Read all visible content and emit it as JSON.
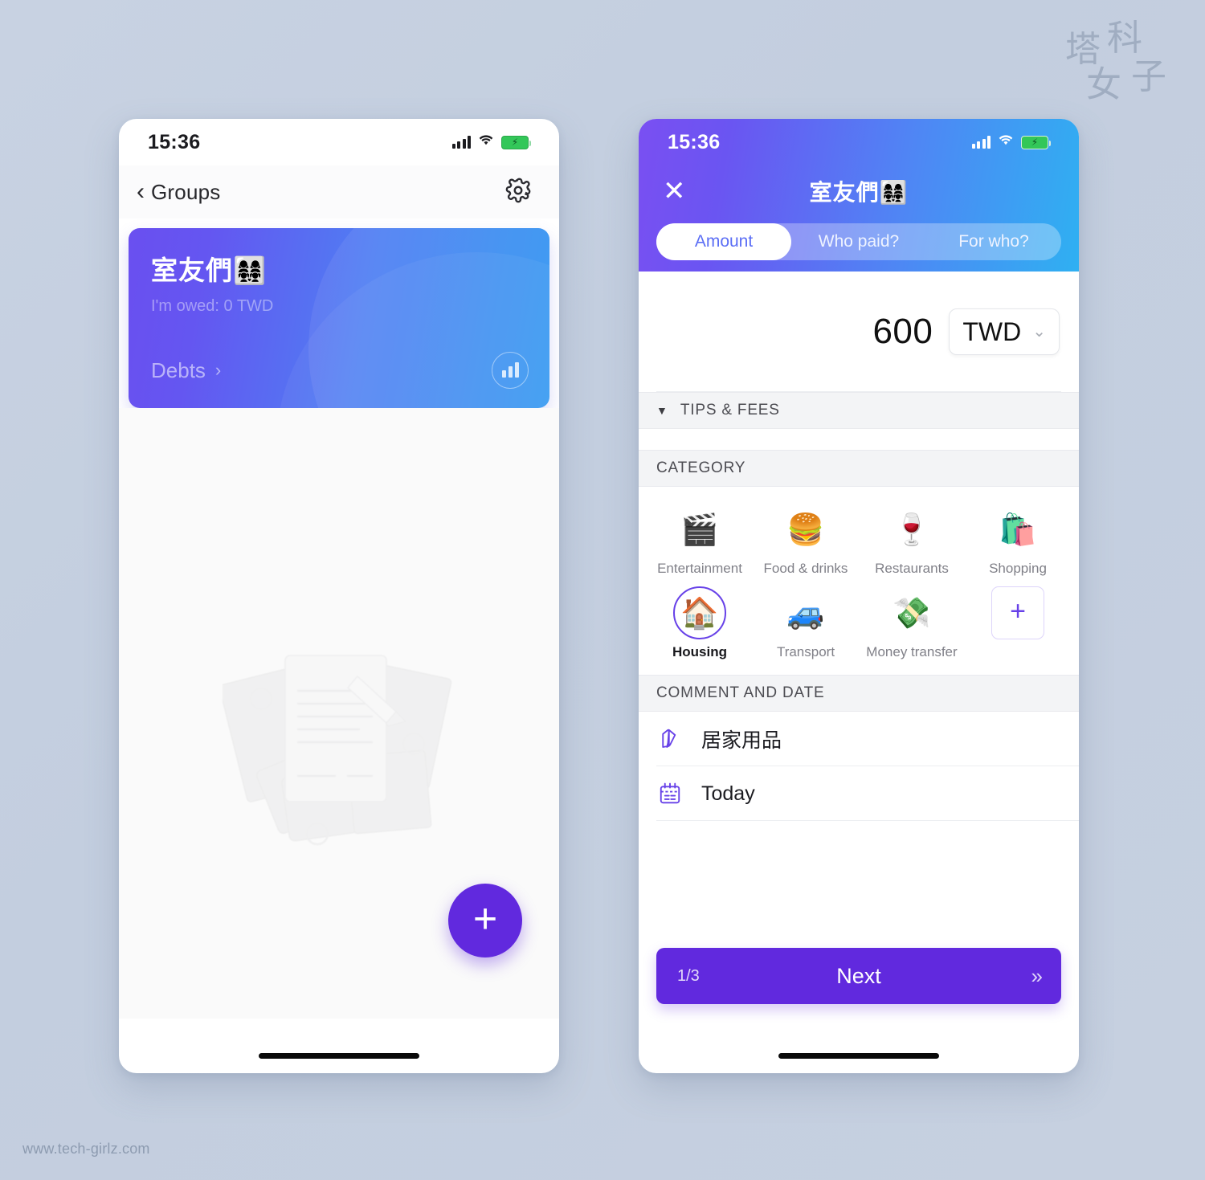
{
  "watermark": {
    "c1": "塔",
    "c2": "科",
    "c3": "女",
    "c4": "子"
  },
  "site_url": "www.tech-girlz.com",
  "colors": {
    "page_bg": "#c4cfdf",
    "accent_purple": "#6129de",
    "selected_ring": "#6741e8",
    "gradient_start": "#6a4ff0",
    "gradient_end": "#2f96f2",
    "battery_green": "#33c759"
  },
  "left_phone": {
    "status_bar": {
      "time": "15:36",
      "signal_icon": "signal-bars-icon",
      "wifi_icon": "wifi-icon",
      "battery_icon": "battery-charging-icon"
    },
    "nav": {
      "back_chevron": "‹",
      "back_label": "Groups",
      "settings_icon": "gear-icon"
    },
    "group_card": {
      "title": "室友們👩‍👩‍👧‍👧",
      "owed_text": "I'm owed: 0 TWD",
      "debts_label": "Debts",
      "debts_arrow": "›",
      "chart_icon": "bar-chart-icon"
    },
    "empty_state": {
      "illustration": "receipts-and-pen-illustration"
    },
    "fab": {
      "icon": "plus-icon",
      "label": "+"
    },
    "home_indicator": "home-indicator"
  },
  "right_phone": {
    "status_bar": {
      "time": "15:36",
      "signal_icon": "signal-bars-icon",
      "wifi_icon": "wifi-icon",
      "battery_icon": "battery-charging-icon"
    },
    "header": {
      "close_icon": "close-icon",
      "close_label": "✕",
      "title": "室友們👩‍👩‍👧‍👧",
      "tabs": [
        {
          "label": "Amount",
          "active": true
        },
        {
          "label": "Who paid?",
          "active": false
        },
        {
          "label": "For who?",
          "active": false
        }
      ]
    },
    "amount": {
      "value": "600",
      "placeholder": "0",
      "currency": "TWD",
      "currency_chevron": "⌄"
    },
    "tips_and_fees": {
      "triangle": "▼",
      "title": "TIPS & FEES"
    },
    "category": {
      "title": "CATEGORY",
      "items": [
        {
          "emoji": "🎬",
          "label": "Entertainment",
          "icon_name": "clapperboard-icon",
          "selected": false
        },
        {
          "emoji": "🍔",
          "label": "Food & drinks",
          "icon_name": "hamburger-icon",
          "selected": false
        },
        {
          "emoji": "🍷",
          "label": "Restaurants",
          "icon_name": "wine-glass-icon",
          "selected": false
        },
        {
          "emoji": "🛍️",
          "label": "Shopping",
          "icon_name": "shopping-bags-icon",
          "selected": false
        },
        {
          "emoji": "🏠",
          "label": "Housing",
          "icon_name": "house-icon",
          "selected": true
        },
        {
          "emoji": "🚙",
          "label": "Transport",
          "icon_name": "car-icon",
          "selected": false
        },
        {
          "emoji": "💸",
          "label": "Money transfer",
          "icon_name": "money-wings-icon",
          "selected": false
        }
      ],
      "add_label": "+"
    },
    "comment_and_date": {
      "title": "COMMENT AND DATE",
      "comment": {
        "icon_name": "note-pencil-icon",
        "text": "居家用品"
      },
      "date": {
        "icon_name": "calendar-icon",
        "text": "Today"
      }
    },
    "next_button": {
      "step": "1/3",
      "label": "Next",
      "chevrons": "»"
    },
    "home_indicator": "home-indicator"
  }
}
